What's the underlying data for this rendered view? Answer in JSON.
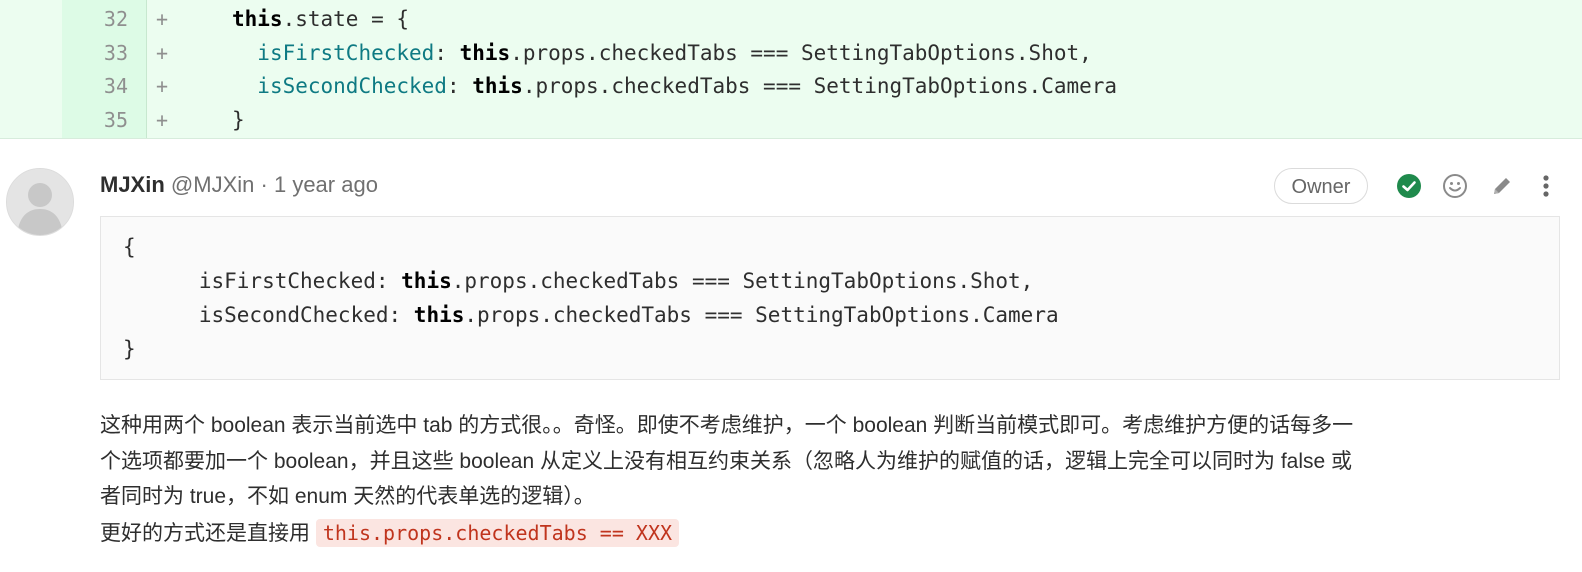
{
  "diff": {
    "lines": [
      {
        "number": "32",
        "marker": "+",
        "parts": [
          {
            "t": "this",
            "c": "kw"
          },
          {
            "t": ".state = {",
            "c": ""
          }
        ]
      },
      {
        "number": "33",
        "marker": "+",
        "parts": [
          {
            "t": "  ",
            "c": ""
          },
          {
            "t": "isFirstChecked",
            "c": "prop"
          },
          {
            "t": ": ",
            "c": ""
          },
          {
            "t": "this",
            "c": "kw"
          },
          {
            "t": ".props.checkedTabs === SettingTabOptions.Shot,",
            "c": ""
          }
        ]
      },
      {
        "number": "34",
        "marker": "+",
        "parts": [
          {
            "t": "  ",
            "c": ""
          },
          {
            "t": "isSecondChecked",
            "c": "prop"
          },
          {
            "t": ": ",
            "c": ""
          },
          {
            "t": "this",
            "c": "kw"
          },
          {
            "t": ".props.checkedTabs === SettingTabOptions.Camera",
            "c": ""
          }
        ]
      },
      {
        "number": "35",
        "marker": "+",
        "parts": [
          {
            "t": "}",
            "c": ""
          }
        ]
      }
    ]
  },
  "comment": {
    "author": "MJXin",
    "handle": "@MJXin",
    "separator": "·",
    "time": "1 year ago",
    "role_badge": "Owner",
    "icons": [
      "resolve-check-icon",
      "emoji-icon",
      "pencil-icon",
      "more-vertical-icon"
    ],
    "colors": {
      "check": "#1f8a4c",
      "inline_code_text": "#c0341d",
      "inline_code_bg": "#fbe5e1",
      "diff_bg": "#ecfdf0"
    },
    "code_block": {
      "lines": [
        [
          {
            "t": "{",
            "c": ""
          }
        ],
        [
          {
            "t": "      isFirstChecked: ",
            "c": ""
          },
          {
            "t": "this",
            "c": "kw"
          },
          {
            "t": ".props.checkedTabs === SettingTabOptions.Shot,",
            "c": ""
          }
        ],
        [
          {
            "t": "      isSecondChecked: ",
            "c": ""
          },
          {
            "t": "this",
            "c": "kw"
          },
          {
            "t": ".props.checkedTabs === SettingTabOptions.Camera",
            "c": ""
          }
        ],
        [
          {
            "t": "}",
            "c": ""
          }
        ]
      ]
    },
    "paragraph_lines": [
      "这种用两个 boolean 表示当前选中 tab 的方式很。。奇怪。即使不考虑维护，一个 boolean 判断当前模式即可。考虑维护方便的话每多一",
      "个选项都要加一个 boolean，并且这些 boolean 从定义上没有相互约束关系（忽略人为维护的赋值的话，逻辑上完全可以同时为 false 或",
      "者同时为 true，不如 enum 天然的代表单选的逻辑）。"
    ],
    "suggestion_prefix": "更好的方式还是直接用",
    "suggestion_code": "this.props.checkedTabs == XXX"
  }
}
